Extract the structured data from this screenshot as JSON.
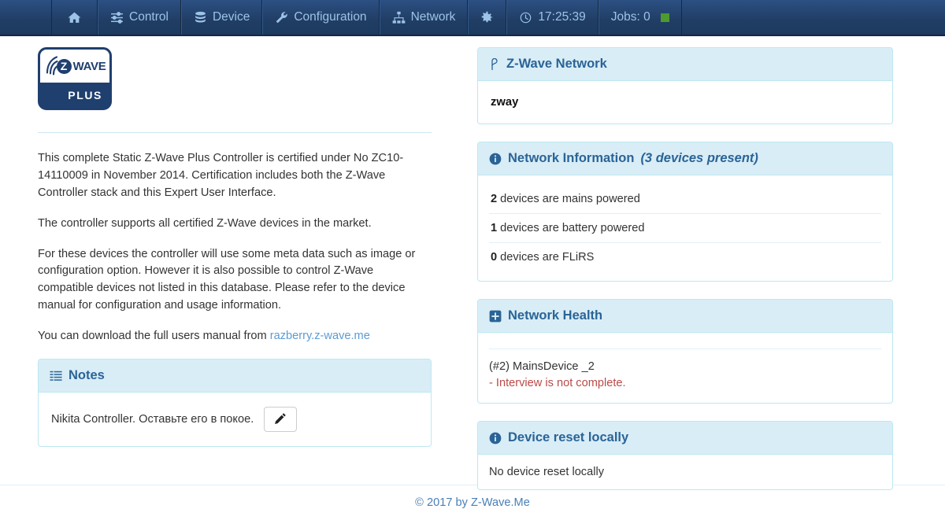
{
  "navbar": {
    "items": [
      {
        "label": "",
        "icon": "home-icon",
        "name": "nav-home"
      },
      {
        "label": "Control",
        "icon": "sliders-icon",
        "name": "nav-control"
      },
      {
        "label": "Device",
        "icon": "database-icon",
        "name": "nav-device"
      },
      {
        "label": "Configuration",
        "icon": "wrench-icon",
        "name": "nav-configuration"
      },
      {
        "label": "Network",
        "icon": "sitemap-icon",
        "name": "nav-network"
      },
      {
        "label": "",
        "icon": "gear-icon",
        "name": "nav-settings"
      }
    ],
    "clock": "17:25:39",
    "clock_icon": "clock-icon",
    "jobs_label": "Jobs: 0",
    "jobs_status_color": "#4e9a2f"
  },
  "logo": {
    "brand_z": "Z",
    "brand_wave": "WAVE",
    "brand_plus": "PLUS"
  },
  "intro": {
    "p1": "This complete Static Z-Wave Plus Controller is certified under No ZC10-14110009 in November 2014. Certification includes both the Z-Wave Controller stack and this Expert User Interface.",
    "p2": "The controller supports all certified Z-Wave devices in the market.",
    "p3": "For these devices the controller will use some meta data such as image or configuration option. However it is also possible to control Z-Wave compatible devices not listed in this database. Please refer to the device manual for configuration and usage information.",
    "p4_prefix": "You can download the full users manual from ",
    "p4_link": "razberry.z-wave.me"
  },
  "notes": {
    "title": "Notes",
    "icon": "list-icon",
    "text": "Nikita Controller. Оставьте его в покое.",
    "edit_icon": "pencil-icon"
  },
  "network_panel": {
    "title": "Z-Wave Network",
    "icon": "branch-icon",
    "name": "zway"
  },
  "network_info": {
    "title": "Network Information",
    "title_suffix": "(3 devices present)",
    "icon": "info-circle-icon",
    "rows": [
      {
        "count": "2",
        "text": " devices are mains powered"
      },
      {
        "count": "1",
        "text": " devices are battery powered"
      },
      {
        "count": "0",
        "text": " devices are FLiRS"
      }
    ]
  },
  "network_health": {
    "title": "Network Health",
    "icon": "plus-square-icon",
    "device": "(#2) MainsDevice _2",
    "error": "- Interview is not complete."
  },
  "device_reset": {
    "title": "Device reset locally",
    "icon": "info-circle-icon",
    "text": "No device reset locally"
  },
  "footer": {
    "text": "© 2017 by Z-Wave.Me"
  }
}
